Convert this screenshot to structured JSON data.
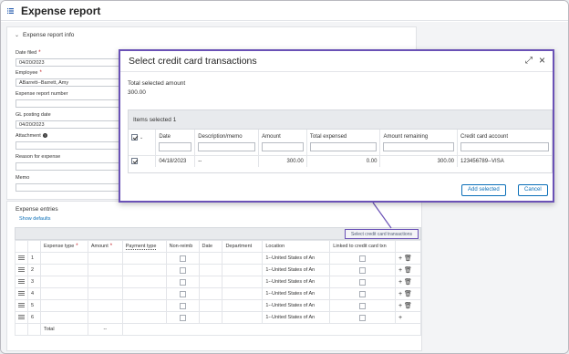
{
  "page": {
    "title": "Expense report"
  },
  "info": {
    "section_title": "Expense report info",
    "date_filed_label": "Date filed",
    "date_filed_value": "04/20/2023",
    "employee_label": "Employee",
    "employee_value": "ABarrett--Barrett, Amy",
    "report_number_label": "Expense report number",
    "gl_date_label": "GL posting date",
    "gl_date_value": "04/20/2023",
    "attachment_label": "Attachment",
    "reason_label": "Reason for expense",
    "memo_label": "Memo"
  },
  "entries": {
    "title": "Expense entries",
    "show_defaults": "Show defaults",
    "select_cc_button": "Select credit card transactions",
    "columns": [
      "Expense type",
      "Amount",
      "Payment type",
      "Non-reimb",
      "Date",
      "Department",
      "Location",
      "Linked to credit card txn"
    ],
    "rows": [
      {
        "num": "1",
        "location": "1--United States of An"
      },
      {
        "num": "2",
        "location": "1--United States of An"
      },
      {
        "num": "3",
        "location": "1--United States of An"
      },
      {
        "num": "4",
        "location": "1--United States of An"
      },
      {
        "num": "5",
        "location": "1--United States of An"
      },
      {
        "num": "6",
        "location": "1--United States of An"
      }
    ],
    "total_label": "Total",
    "total_value": "--"
  },
  "modal": {
    "title": "Select credit card transactions",
    "total_selected_label": "Total selected amount",
    "total_selected_value": "300.00",
    "items_selected": "Items selected 1",
    "columns": [
      "Date",
      "Description/memo",
      "Amount",
      "Total expensed",
      "Amount remaining",
      "Credit card account"
    ],
    "row": {
      "date": "04/18/2023",
      "description": "--",
      "amount": "300.00",
      "total_expensed": "0.00",
      "amount_remaining": "300.00",
      "account": "123456789--VISA"
    },
    "add_button": "Add selected",
    "cancel_button": "Cancel"
  },
  "colors": {
    "accent": "#6a51b6",
    "link": "#0a6fb8",
    "required": "#c0141b"
  }
}
